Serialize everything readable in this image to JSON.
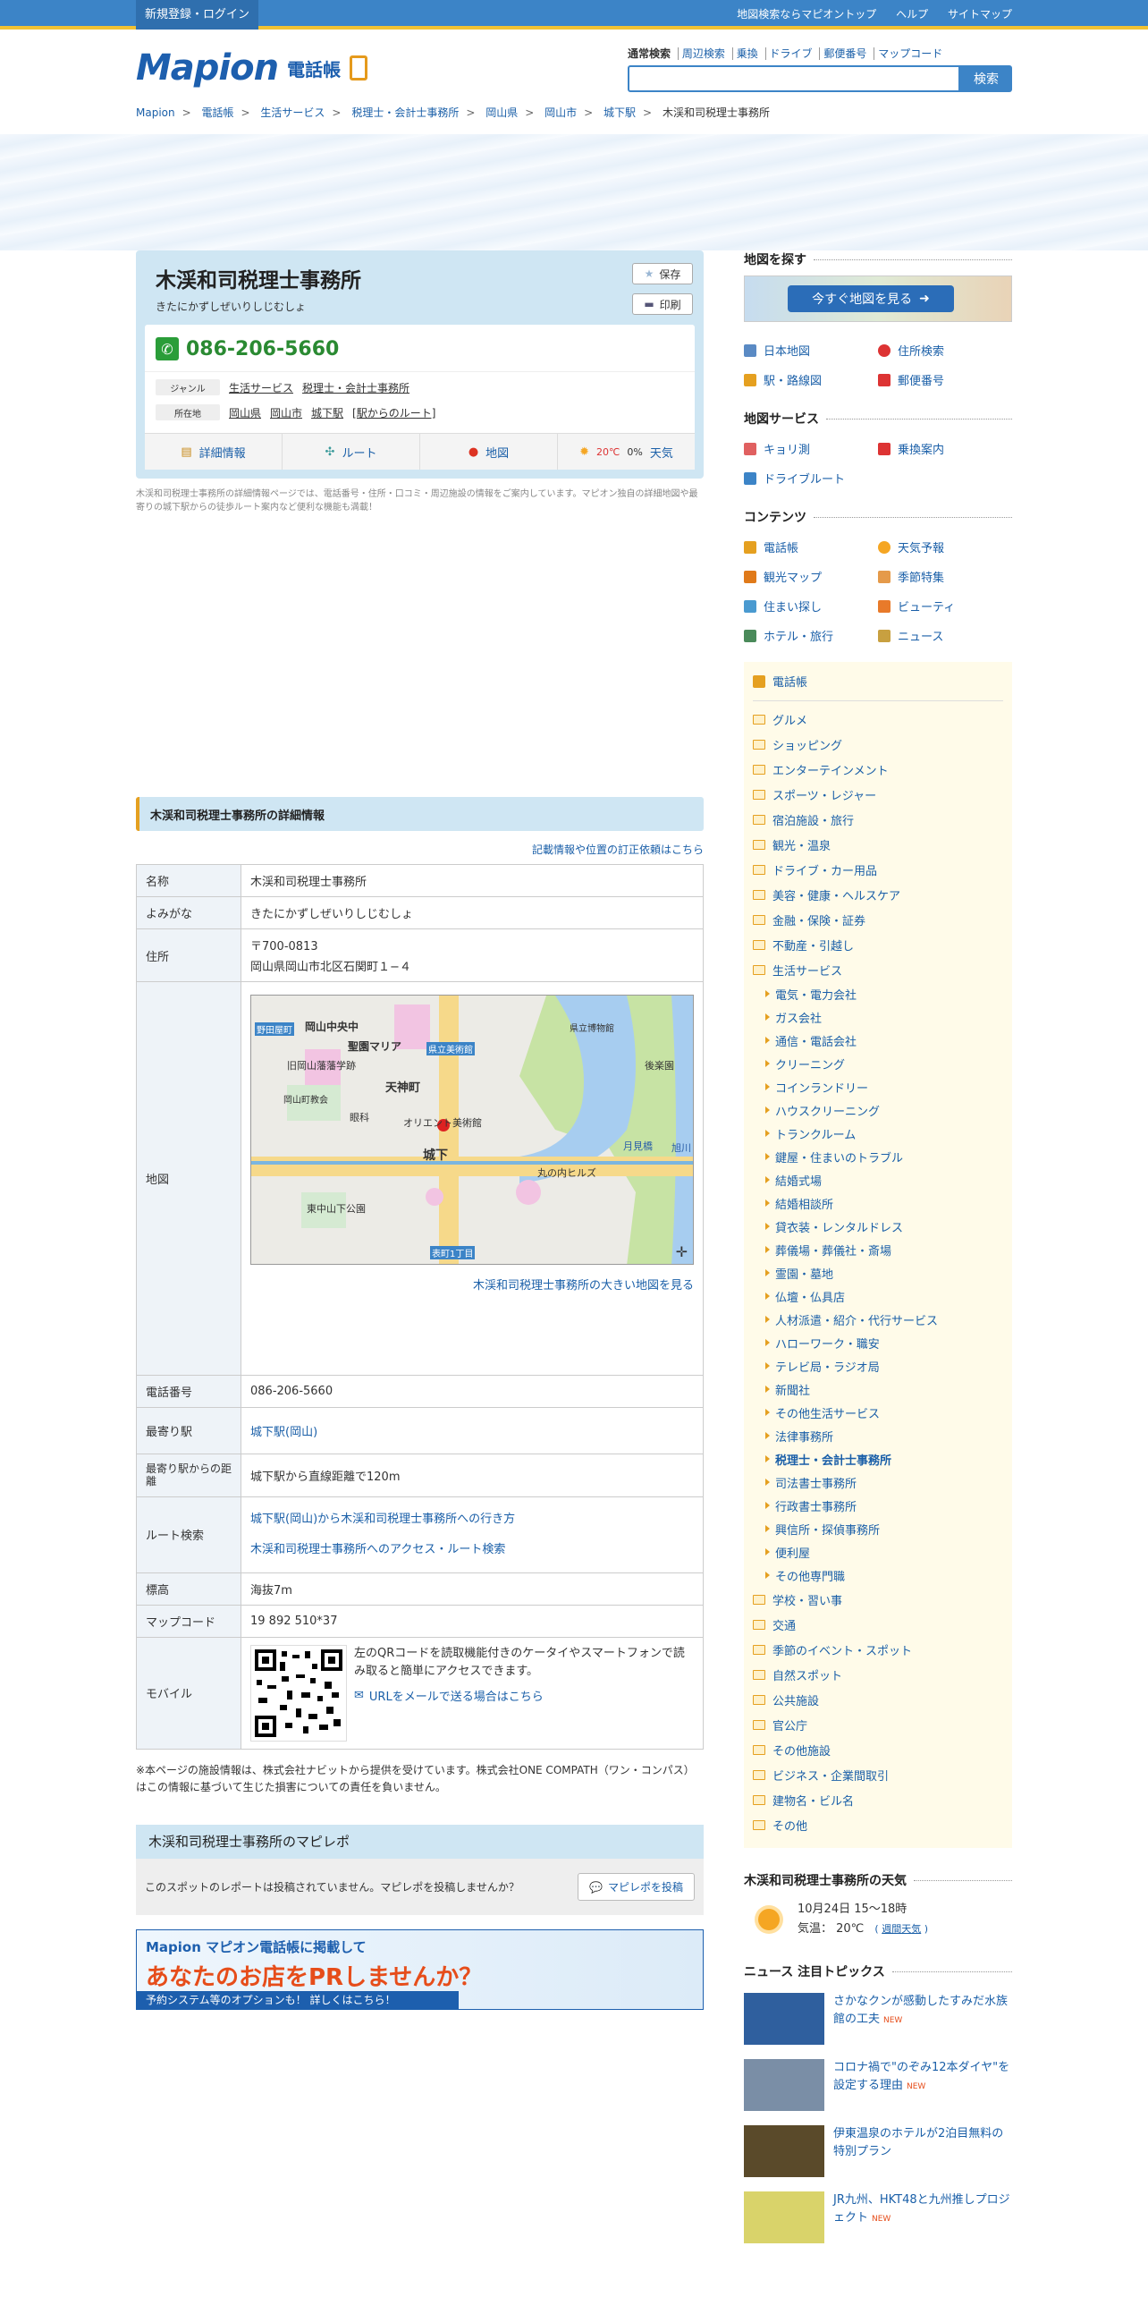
{
  "topbar": {
    "login": "新規登録・ログイン",
    "links": [
      "地図検索ならマピオントップ",
      "ヘルプ",
      "サイトマップ"
    ]
  },
  "logo": {
    "brand": "Mapion",
    "service": "電話帳"
  },
  "search": {
    "tabs": [
      "通常検索",
      "周辺検索",
      "乗換",
      "ドライブ",
      "郵便番号",
      "マップコード"
    ],
    "placeholder": "",
    "button": "検索"
  },
  "breadcrumb": [
    "Mapion",
    "電話帳",
    "生活サービス",
    "税理士・会計士事務所",
    "岡山県",
    "岡山市",
    "城下駅",
    "木渓和司税理士事務所"
  ],
  "business": {
    "name": "木渓和司税理士事務所",
    "kana": "きたにかずしぜいりしじむしょ",
    "save": "保存",
    "print": "印刷",
    "phone": "086-206-5660",
    "genre_label": "ジャンル",
    "genres": [
      "生活サービス",
      "税理士・会計士事務所"
    ],
    "address_label": "所在地",
    "address_links": [
      "岡山県",
      "岡山市",
      "城下駅",
      "[駅からのルート]"
    ],
    "nav": {
      "detail": "詳細情報",
      "route": "ルート",
      "map": "地図",
      "weather_temp": "20℃",
      "weather_rain": "0%",
      "weather": "天気"
    },
    "desc": "木渓和司税理士事務所の詳細情報ページでは、電話番号・住所・口コミ・周辺施設の情報をご案内しています。マピオン独自の詳細地図や最寄りの城下駅からの徒歩ルート案内など便利な機能も満載！"
  },
  "detail": {
    "heading": "木渓和司税理士事務所の詳細情報",
    "correction_link": "記載情報や位置の訂正依頼はこちら",
    "rows": {
      "name_label": "名称",
      "name": "木渓和司税理士事務所",
      "kana_label": "よみがな",
      "kana": "きたにかずしぜいりしじむしょ",
      "address_label": "住所",
      "zip": "〒700-0813",
      "address": "岡山県岡山市北区石関町１−４",
      "map_label": "地図",
      "map_link": "木渓和司税理士事務所の大きい地図を見る",
      "phone_label": "電話番号",
      "phone": "086-206-5660",
      "station_label": "最寄り駅",
      "station": "城下駅(岡山)",
      "distance_label": "最寄り駅からの距離",
      "distance": "城下駅から直線距離で120m",
      "route_label": "ルート検索",
      "route1": "城下駅(岡山)から木渓和司税理士事務所への行き方",
      "route2": "木渓和司税理士事務所へのアクセス・ルート検索",
      "altitude_label": "標高",
      "altitude": "海抜7m",
      "mapcode_label": "マップコード",
      "mapcode": "19 892 510*37",
      "mobile_label": "モバイル",
      "mobile_text": "左のQRコードを読取機能付きのケータイやスマートフォンで読み取ると簡単にアクセスできます。",
      "mobile_mail": "URLをメールで送る場合はこちら"
    },
    "map_labels": [
      "岡山中央中",
      "聖園マリア",
      "旧岡山藩藩学跡",
      "県立美術館",
      "天神町",
      "岡山町教会",
      "眼科",
      "オリエント美術館",
      "城下",
      "東中山下公園",
      "丸の内ヒルズ",
      "県立博物館",
      "後楽園",
      "月見橋",
      "旭川",
      "野田屋町",
      "表町1丁目"
    ],
    "note": "※本ページの施設情報は、株式会社ナビットから提供を受けています。株式会社ONE COMPATH（ワン・コンパス）はこの情報に基づいて生じた損害についての責任を負いません。"
  },
  "mapirepo": {
    "heading": "木渓和司税理士事務所のマピレポ",
    "empty": "このスポットのレポートは投稿されていません。マピレポを投稿しませんか？",
    "post": "マピレポを投稿"
  },
  "banner": {
    "line1": "Mapion マピオン電話帳に掲載して",
    "line2": "あなたのお店をPRしませんか？",
    "line3": "予約システム等のオプションも！ 詳しくはこちら！"
  },
  "side": {
    "find_map": "地図を探す",
    "map_btn": "今すぐ地図を見る",
    "find_items": [
      "日本地図",
      "住所検索",
      "駅・路線図",
      "郵便番号"
    ],
    "service_head": "地図サービス",
    "service_items": [
      "キョリ測",
      "乗換案内",
      "ドライブルート"
    ],
    "content_head": "コンテンツ",
    "content_items": [
      "電話帳",
      "天気予報",
      "観光マップ",
      "季節特集",
      "住まい探し",
      "ビューティ",
      "ホテル・旅行",
      "ニュース"
    ],
    "phonebook": "電話帳",
    "cats_top": [
      "グルメ",
      "ショッピング",
      "エンターテインメント",
      "スポーツ・レジャー",
      "宿泊施設・旅行",
      "観光・温泉",
      "ドライブ・カー用品",
      "美容・健康・ヘルスケア",
      "金融・保険・証券",
      "不動産・引越し",
      "生活サービス"
    ],
    "subcats": [
      "電気・電力会社",
      "ガス会社",
      "通信・電話会社",
      "クリーニング",
      "コインランドリー",
      "ハウスクリーニング",
      "トランクルーム",
      "鍵屋・住まいのトラブル",
      "結婚式場",
      "結婚相談所",
      "貸衣装・レンタルドレス",
      "葬儀場・葬儀社・斎場",
      "霊園・墓地",
      "仏壇・仏具店",
      "人材派遣・紹介・代行サービス",
      "ハローワーク・職安",
      "テレビ局・ラジオ局",
      "新聞社",
      "その他生活サービス",
      "法律事務所",
      "税理士・会計士事務所",
      "司法書士事務所",
      "行政書士事務所",
      "興信所・探偵事務所",
      "便利屋",
      "その他専門職"
    ],
    "cats_bottom": [
      "学校・習い事",
      "交通",
      "季節のイベント・スポット",
      "自然スポット",
      "公共施設",
      "官公庁",
      "その他施設",
      "ビジネス・企業間取引",
      "建物名・ビル名",
      "その他"
    ],
    "weather_head": "木渓和司税理士事務所の天気",
    "weather_date": "10月24日 15～18時",
    "weather_temp": "気温： 20℃",
    "weather_week": "週間天気",
    "news_head": "ニュース 注目トピックス",
    "news": [
      {
        "title": "さかなクンが感動したすみだ水族館の工夫",
        "new": "NEW",
        "color": "#2f5f9e"
      },
      {
        "title": "コロナ禍で\"のぞみ12本ダイヤ\"を設定する理由",
        "new": "NEW",
        "color": "#7a8ea6"
      },
      {
        "title": "伊東温泉のホテルが2泊目無料の特別プラン",
        "new": "",
        "color": "#5a4a2a"
      },
      {
        "title": "JR九州、HKT48と九州推しプロジェクト",
        "new": "NEW",
        "color": "#d9d36a"
      }
    ]
  }
}
